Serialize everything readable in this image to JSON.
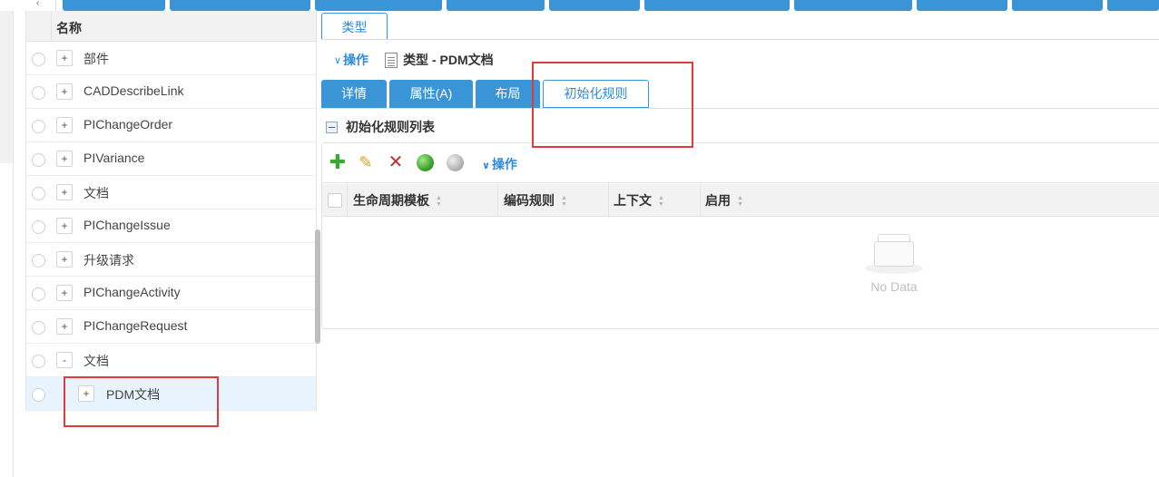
{
  "tree": {
    "header_label": "名称",
    "rows": [
      {
        "expander": "+",
        "label": "部件"
      },
      {
        "expander": "+",
        "label": "CADDescribeLink"
      },
      {
        "expander": "+",
        "label": "PIChangeOrder"
      },
      {
        "expander": "+",
        "label": "PIVariance"
      },
      {
        "expander": "+",
        "label": "文档"
      },
      {
        "expander": "+",
        "label": "PIChangeIssue"
      },
      {
        "expander": "+",
        "label": "升级请求"
      },
      {
        "expander": "+",
        "label": "PIChangeActivity"
      },
      {
        "expander": "+",
        "label": "PIChangeRequest"
      },
      {
        "expander": "-",
        "label": "文档"
      },
      {
        "expander": "+",
        "label": "PDM文档",
        "selected": true
      }
    ]
  },
  "main": {
    "type_tab": "类型",
    "ops_label": "操作",
    "title": "类型 - PDM文档",
    "tabs": [
      {
        "label": "详情"
      },
      {
        "label": "属性(A)"
      },
      {
        "label": "布局"
      },
      {
        "label": "初始化规则",
        "active": true
      }
    ],
    "section_title": "初始化规则列表",
    "toolbar": {
      "icons": [
        "add-icon",
        "edit-icon",
        "delete-icon",
        "enable-icon",
        "disable-icon"
      ],
      "ops_label": "操作"
    },
    "columns": [
      "生命周期模板",
      "编码规则",
      "上下文",
      "启用"
    ],
    "empty_text": "No Data"
  },
  "colors": {
    "accent": "#3a95d6",
    "link": "#2f8bd8",
    "highlight": "#e03a3a",
    "selected_row": "#e8f4fd"
  }
}
